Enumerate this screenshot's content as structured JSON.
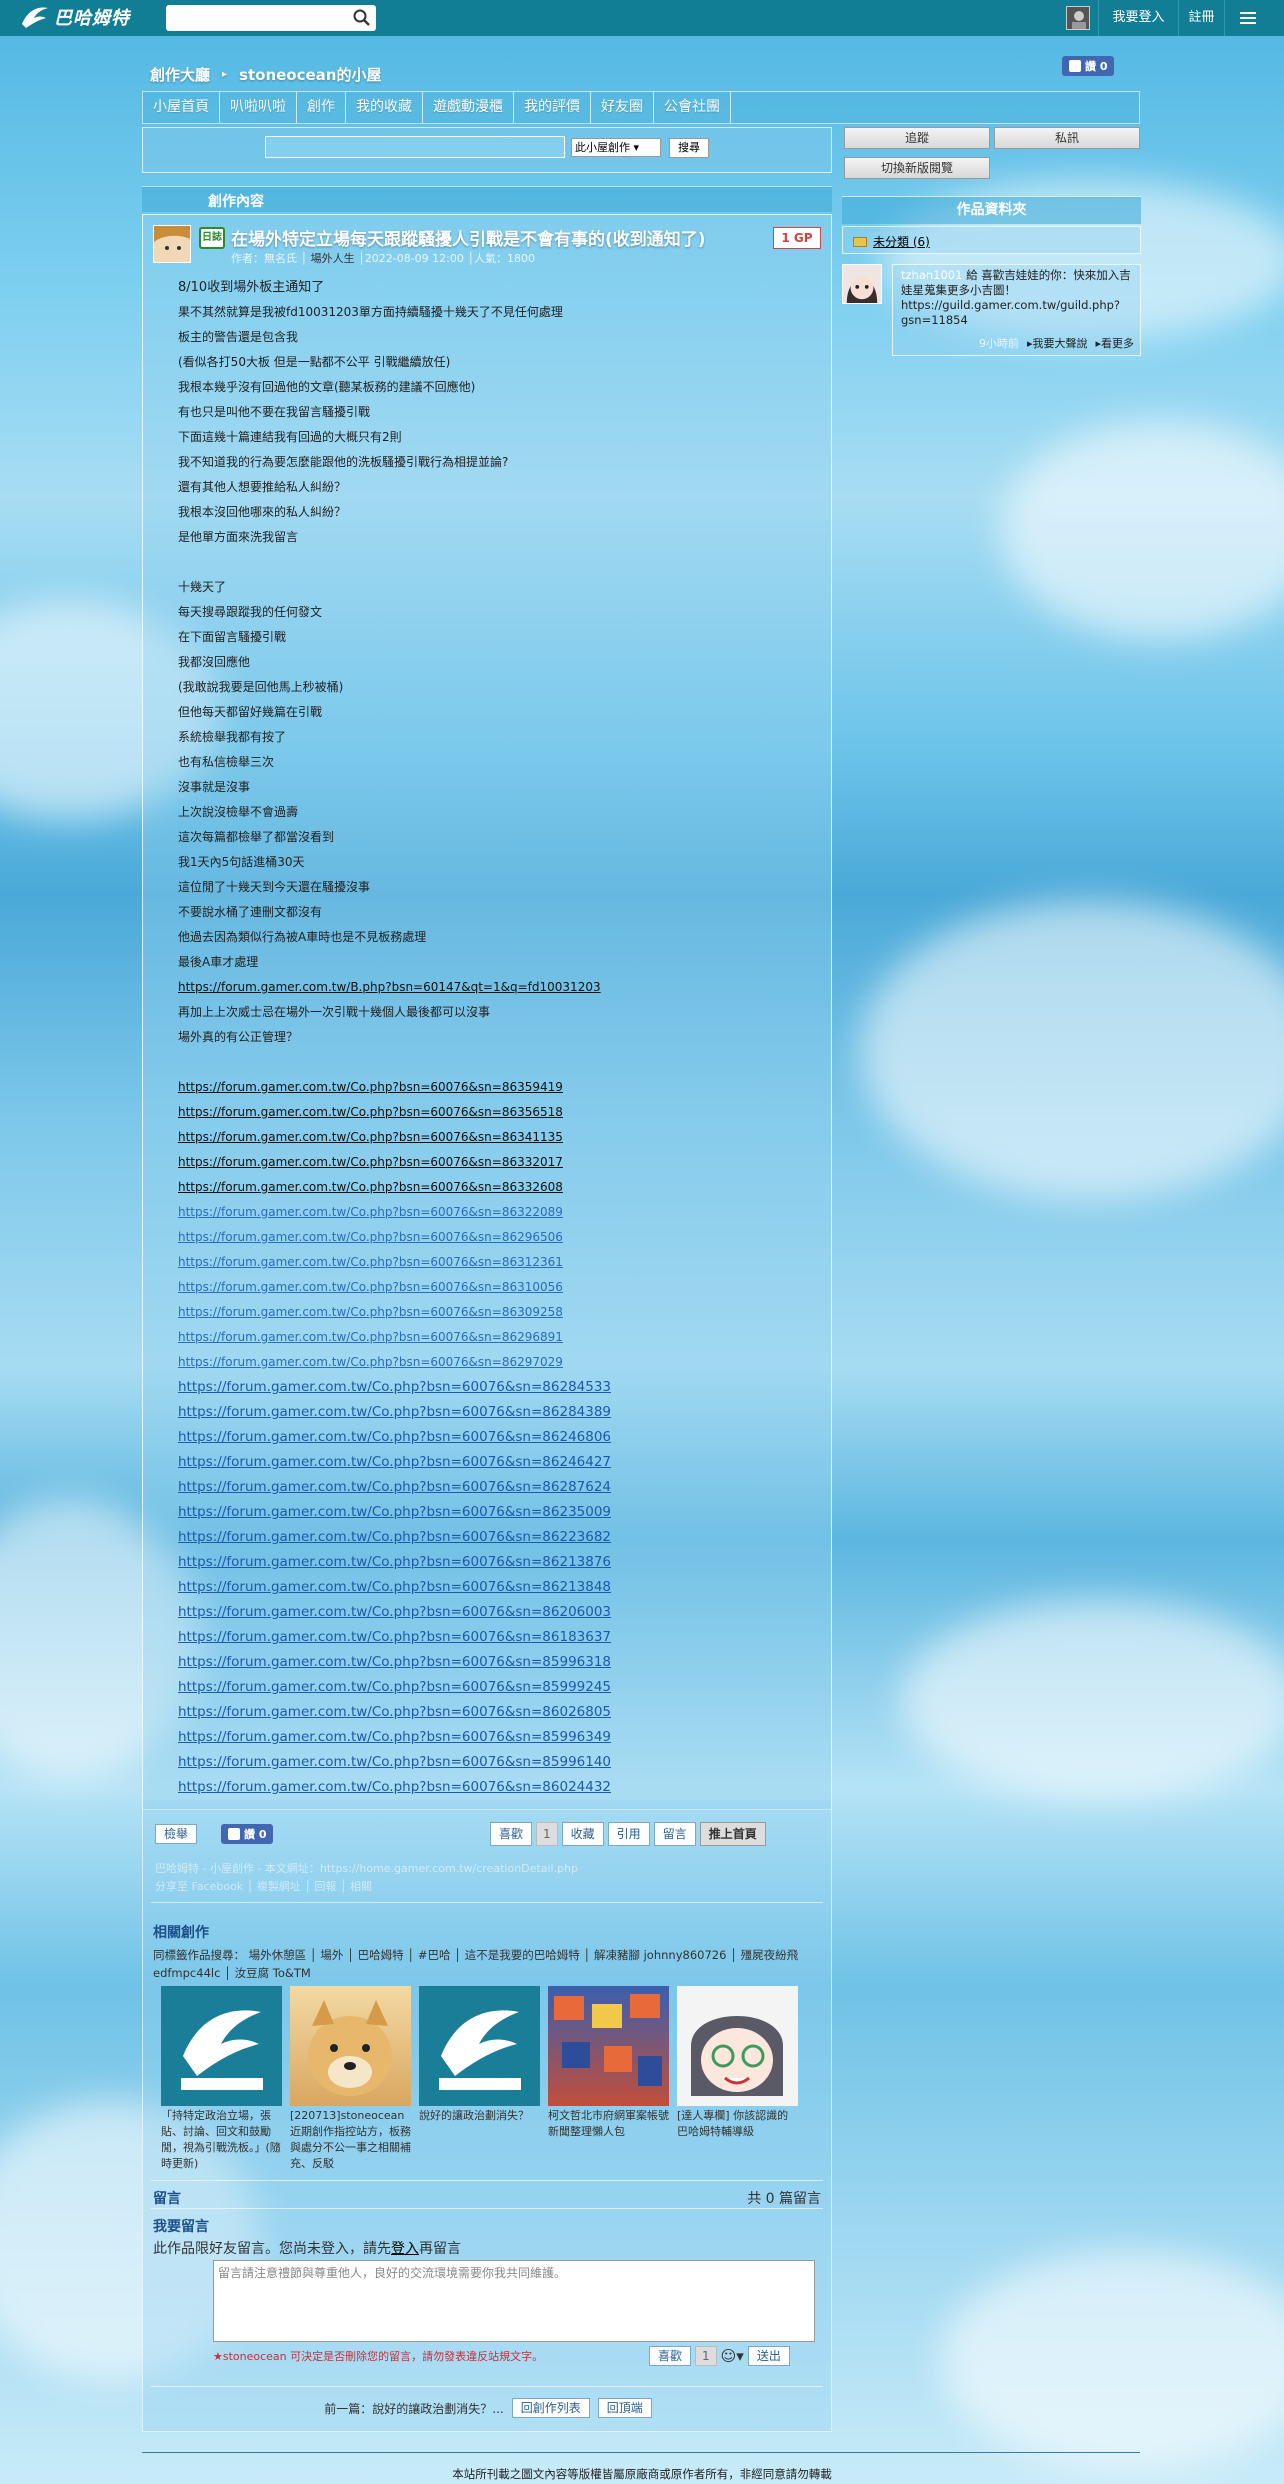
{
  "topbar": {
    "logo_text": "巴哈姆特",
    "login_label": "我要登入",
    "register_label": "註冊"
  },
  "header": {
    "breadcrumb_root": "創作大廳",
    "breadcrumb_home": "stoneocean的小屋",
    "like_label": "讚 0"
  },
  "nav": {
    "items": [
      "小屋首頁",
      "叭啦叭啦",
      "創作",
      "我的收藏",
      "遊戲動漫櫃",
      "我的評價",
      "好友圈",
      "公會社團"
    ]
  },
  "search": {
    "scope": "此小屋創作",
    "button": "搜尋"
  },
  "section": {
    "title": "創作內容"
  },
  "post": {
    "type_badge": "日誌",
    "title": "在場外特定立場每天跟蹤騷擾人引戰是不會有事的(收到通知了)",
    "gp_label": "1 GP",
    "meta_prefix": "作者：無名氏 │",
    "meta_board": "場外人生",
    "meta_suffix": "│2022-08-09 12:00 │人氣：1800",
    "lines": [
      "8/10收到場外板主通知了",
      "果不其然就算是我被fd10031203單方面持續騷擾十幾天了不見任何處理",
      "板主的警告還是包含我",
      "(看似各打50大板 但是一點都不公平 引戰繼續放任)",
      "我根本幾乎沒有回過他的文章(聽某板務的建議不回應他)",
      "有也只是叫他不要在我留言騷擾引戰",
      "下面這幾十篇連結我有回過的大概只有2則",
      "我不知道我的行為要怎麼能跟他的洗板騷擾引戰行為相提並論?",
      "還有其他人想要推給私人糾紛？",
      "我根本沒回他哪來的私人糾紛？",
      "是他單方面來洗我留言",
      "",
      "十幾天了",
      "每天搜尋跟蹤我的任何發文",
      "在下面留言騷擾引戰",
      "我都沒回應他",
      "(我敢說我要是回他馬上秒被桶)",
      "但他每天都留好幾篇在引戰",
      "系統檢舉我都有按了",
      "也有私信檢舉三次",
      "沒事就是沒事",
      "上次說沒檢舉不會過壽",
      "這次每篇都檢舉了都當沒看到",
      "我1天內5句話進桶30天",
      "這位閒了十幾天到今天還在騷擾沒事",
      "不要說水桶了連刪文都沒有",
      "他過去因為類似行為被A車時也是不見板務處理",
      "最後A車才處理"
    ],
    "link_main": "https://forum.gamer.com.tw/B.php?bsn=60147&qt=1&q=fd10031203",
    "lines_after": [
      "再加上上次威士忌在場外一次引戰十幾個人最後都可以沒事",
      "場外真的有公正管理？"
    ],
    "links_dark": [
      "https://forum.gamer.com.tw/Co.php?bsn=60076&sn=86359419",
      "https://forum.gamer.com.tw/Co.php?bsn=60076&sn=86356518",
      "https://forum.gamer.com.tw/Co.php?bsn=60076&sn=86341135",
      "https://forum.gamer.com.tw/Co.php?bsn=60076&sn=86332017",
      "https://forum.gamer.com.tw/Co.php?bsn=60076&sn=86332608"
    ],
    "links_blue": [
      "https://forum.gamer.com.tw/Co.php?bsn=60076&sn=86322089",
      "https://forum.gamer.com.tw/Co.php?bsn=60076&sn=86296506",
      "https://forum.gamer.com.tw/Co.php?bsn=60076&sn=86312361",
      "https://forum.gamer.com.tw/Co.php?bsn=60076&sn=86310056",
      "https://forum.gamer.com.tw/Co.php?bsn=60076&sn=86309258",
      "https://forum.gamer.com.tw/Co.php?bsn=60076&sn=86296891",
      "https://forum.gamer.com.tw/Co.php?bsn=60076&sn=86297029"
    ],
    "links_big": [
      "https://forum.gamer.com.tw/Co.php?bsn=60076&sn=86284533",
      "https://forum.gamer.com.tw/Co.php?bsn=60076&sn=86284389",
      "https://forum.gamer.com.tw/Co.php?bsn=60076&sn=86246806",
      "https://forum.gamer.com.tw/Co.php?bsn=60076&sn=86246427",
      "https://forum.gamer.com.tw/Co.php?bsn=60076&sn=86287624",
      "https://forum.gamer.com.tw/Co.php?bsn=60076&sn=86235009",
      "https://forum.gamer.com.tw/Co.php?bsn=60076&sn=86223682",
      "https://forum.gamer.com.tw/Co.php?bsn=60076&sn=86213876",
      "https://forum.gamer.com.tw/Co.php?bsn=60076&sn=86213848",
      "https://forum.gamer.com.tw/Co.php?bsn=60076&sn=86206003",
      "https://forum.gamer.com.tw/Co.php?bsn=60076&sn=86183637",
      "https://forum.gamer.com.tw/Co.php?bsn=60076&sn=85996318",
      "https://forum.gamer.com.tw/Co.php?bsn=60076&sn=85999245",
      "https://forum.gamer.com.tw/Co.php?bsn=60076&sn=86026805",
      "https://forum.gamer.com.tw/Co.php?bsn=60076&sn=85996349",
      "https://forum.gamer.com.tw/Co.php?bsn=60076&sn=85996140",
      "https://forum.gamer.com.tw/Co.php?bsn=60076&sn=86024432"
    ]
  },
  "actions": {
    "report": "檢舉",
    "like_label": "讚 0",
    "like_btn": "喜歡",
    "like_count": "1",
    "collect": "收藏",
    "quote": "引用",
    "comment": "留言",
    "recommend": "推上首頁"
  },
  "footer_faint": {
    "line1": "巴哈姆特 - 小屋創作 - 本文網址：https://home.gamer.com.tw/creationDetail.php",
    "line2": "分享至 Facebook │ 複製網址 │ 回報 │ 相關"
  },
  "related": {
    "title": "相關創作",
    "tags": "同標籤作品搜尋： 場外休憩區 │ 場外 │ 巴哈姆特 │ #巴哈 │ 這不是我要的巴哈姆特 │ 解凍豬腳 johnny860726 │ 殭屍夜紛飛 edfmpc44lc │ 汝豆腐 To&TM",
    "items": [
      {
        "caption": "「持特定政治立場，張貼、討論、回文和鼓勵閒，視為引戰洗板。」(隨時更新)"
      },
      {
        "caption": "[220713]stoneocean近期創作指控站方，板務與處分不公一事之相關補充、反駁"
      },
      {
        "caption": "說好的讓政治劃消失？"
      },
      {
        "caption": "柯文哲北市府網軍案帳號新聞整理懶人包"
      },
      {
        "caption": "[達人專欄] 你該認識的巴哈姆特輔導級"
      }
    ]
  },
  "comments": {
    "head": "留言",
    "count": "共 0 篇留言",
    "my_head": "我要留言",
    "login_prefix": "此作品限好友留言。您尚未登入，請先",
    "login_link": "登入",
    "login_suffix": "再留言",
    "placeholder": "留言請注意禮節與尊重他人，良好的交流環境需要你我共同維護。",
    "warn": "★stoneocean 可決定是否刪除您的留言，請勿發表違反站規文字。",
    "like_btn": "喜歡",
    "like_count": "1",
    "send": "送出"
  },
  "bottom_nav": {
    "prev": "前一篇：說好的讓政治劃消失？...",
    "list": "回創作列表",
    "top": "回頂端"
  },
  "sidebar": {
    "follow": "追蹤",
    "message": "私訊",
    "switch": "切換新版閱覽",
    "folder_title": "作品資料夾",
    "folder_item": "未分類 (6)",
    "activity_user": "tzhan1001",
    "activity_text": " 給 喜歡吉娃娃的你：快來加入吉娃星蒐集更多小吉圖！https://guild.gamer.com.tw/guild.php?gsn=11854",
    "activity_time": "9小時前",
    "activity_say": "我要大聲說",
    "activity_more": "看更多"
  },
  "footer": {
    "copyright": "本站所刊載之圖文內容等版權皆屬原廠商或原作者所有，非經同意請勿轉載"
  }
}
